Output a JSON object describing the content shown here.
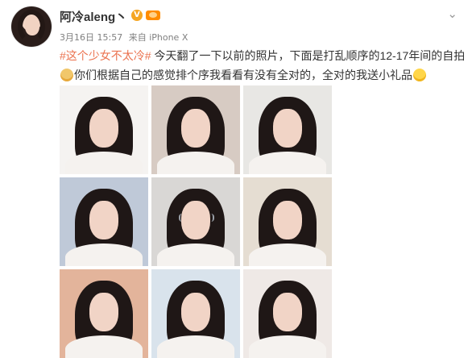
{
  "post": {
    "user_name": "阿冷aleng丶",
    "verified_badge": "V",
    "timestamp": "3月16日 15:57",
    "source": "来自 iPhone X",
    "hashtag": "#这个少女不太冷#",
    "text_part1": " 今天翻了一下以前的照片，下面是打乱顺序的12-17年间的自拍",
    "text_part2": "你们根据自己的感觉排个序我看看有没有全对的，全对的我送小礼品",
    "icons": {
      "chevron": "chevron-down-icon",
      "badge": "vip-badge-icon",
      "member": "member-badge-icon",
      "emoji1": "cat-emoji-icon",
      "emoji2": "smile-emoji-icon"
    }
  },
  "photos": [
    {
      "name": "photo-1",
      "bg": "#f5f3f1"
    },
    {
      "name": "photo-2",
      "bg": "#d7cbc3"
    },
    {
      "name": "photo-3",
      "bg": "#e8e7e4"
    },
    {
      "name": "photo-4",
      "bg": "#bfc9d8"
    },
    {
      "name": "photo-5",
      "bg": "#d9d7d5"
    },
    {
      "name": "photo-6",
      "bg": "#e5ddd2"
    },
    {
      "name": "photo-7",
      "bg": "#e3b49b"
    },
    {
      "name": "photo-8",
      "bg": "#d9e3ec"
    },
    {
      "name": "photo-9",
      "bg": "#efe9e6"
    }
  ]
}
